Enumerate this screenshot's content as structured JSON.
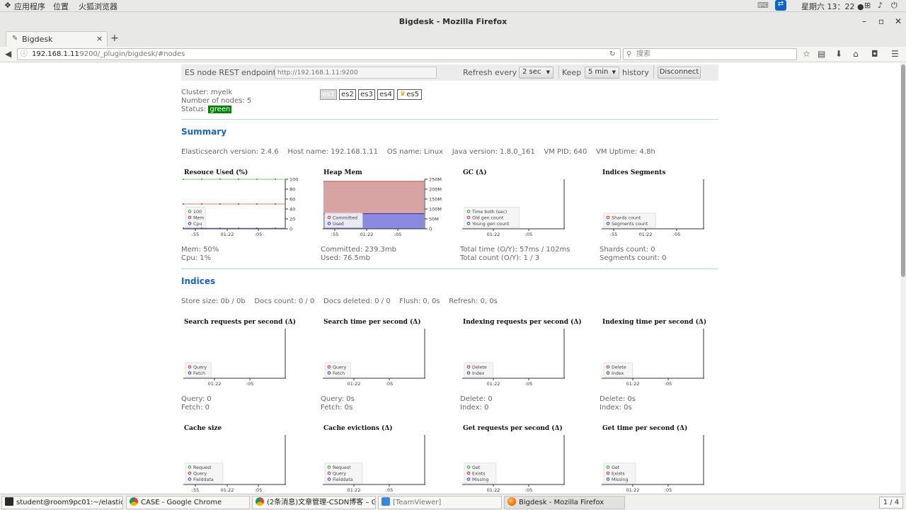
{
  "system_bar": {
    "apps": "应用程序",
    "places": "位置",
    "browser": "火狐浏览器",
    "clock": "星期六 13：22 ●"
  },
  "window": {
    "title": "Bigdesk - Mozilla Firefox"
  },
  "tab": {
    "label": "Bigdesk",
    "close": "×",
    "new_tab": "+"
  },
  "nav": {
    "url_host": "192.168.1.11",
    "url_rest": ":9200/_plugin/bigdesk/#nodes",
    "search_placeholder": "搜索"
  },
  "endpoint": {
    "label": "ES node REST endpoint",
    "placeholder": "http://192.168.1.11:9200",
    "refresh_label": "Refresh every",
    "refresh_value": "2 sec",
    "keep_label": "Keep",
    "keep_value": "5 min",
    "history_label": "history",
    "disconnect": "Disconnect"
  },
  "cluster": {
    "name_line": "Cluster: myelk",
    "nodes_line": "Number of nodes: 5",
    "status_label": "Status:",
    "status_value": "green",
    "status_color": "#008000",
    "nodes": [
      "es1",
      "es2",
      "es3",
      "es4",
      "es5"
    ],
    "selected": "es1"
  },
  "summary": {
    "heading": "Summary",
    "info": "Elasticsearch version: 2.4.6    Host name: 192.168.1.11    OS name: Linux    Java version: 1.8.0_161    VM PID: 640    VM Uptime: 4.8h"
  },
  "indices": {
    "heading": "Indices",
    "info": "Store size: 0b / 0b    Docs count: 0 / 0    Docs deleted: 0 / 0    Flush: 0, 0s    Refresh: 0, 0s"
  },
  "charts": [
    {
      "title": "Resouce Used (%)",
      "legend": [
        "100",
        "Mem",
        "Cpu"
      ],
      "colors": [
        "#2ca02c",
        "#d62728",
        "#1f3fbf"
      ],
      "yticks": [
        "100",
        "80",
        "60",
        "40",
        "20",
        "0"
      ],
      "xticks": [
        ":55",
        "01:22",
        ":05"
      ],
      "stats": [
        "Mem: 50%",
        "Cpu: 1%"
      ],
      "kind": "resource"
    },
    {
      "title": "Heap Mem",
      "legend": [
        "Committed",
        "Used"
      ],
      "colors": [
        "#d62728",
        "#1f3fbf"
      ],
      "yticks": [
        "250M",
        "200M",
        "150M",
        "100M",
        "50M",
        "0"
      ],
      "xticks": [
        ":55",
        "01:22",
        ":05"
      ],
      "stats": [
        "Committed: 239.3mb",
        "Used: 76.5mb"
      ],
      "kind": "heap"
    },
    {
      "title": "GC (Δ)",
      "legend": [
        "Time both (sec)",
        "Old gen count",
        "Young gen count"
      ],
      "colors": [
        "#2ca02c",
        "#d62728",
        "#1f3fbf"
      ],
      "yticks": [],
      "xticks": [
        "01:22",
        ":05"
      ],
      "stats": [
        "Total time (O/Y): 57ms / 102ms",
        "Total count (O/Y): 1 / 3"
      ],
      "kind": "empty"
    },
    {
      "title": "Indices Segments",
      "legend": [
        "Shards count",
        "Segments count"
      ],
      "colors": [
        "#d62728",
        "#1f3fbf"
      ],
      "yticks": [],
      "xticks": [
        ":55",
        "01:22",
        ":05"
      ],
      "stats": [
        "Shards count: 0",
        "Segments count: 0"
      ],
      "kind": "empty"
    },
    {
      "title": "Search requests per second (Δ)",
      "legend": [
        "Query",
        "Fetch"
      ],
      "colors": [
        "#d62728",
        "#1f3fbf"
      ],
      "yticks": [],
      "xticks": [
        "01:22",
        ":05"
      ],
      "stats": [
        "Query: 0",
        "Fetch: 0"
      ],
      "kind": "empty"
    },
    {
      "title": "Search time per second (Δ)",
      "legend": [
        "Query",
        "Fetch"
      ],
      "colors": [
        "#d62728",
        "#1f3fbf"
      ],
      "yticks": [],
      "xticks": [
        "01:22",
        ":05"
      ],
      "stats": [
        "Query: 0s",
        "Fetch: 0s"
      ],
      "kind": "empty"
    },
    {
      "title": "Indexing requests per second (Δ)",
      "legend": [
        "Delete",
        "Index"
      ],
      "colors": [
        "#d62728",
        "#1f3fbf"
      ],
      "yticks": [],
      "xticks": [
        "01:22",
        ":05"
      ],
      "stats": [
        "Delete: 0",
        "Index: 0"
      ],
      "kind": "empty"
    },
    {
      "title": "Indexing time per second (Δ)",
      "legend": [
        "Delete",
        "Index"
      ],
      "colors": [
        "#d62728",
        "#1f3fbf"
      ],
      "yticks": [],
      "xticks": [
        "01:22",
        ":05"
      ],
      "stats": [
        "Delete: 0s",
        "Index: 0s"
      ],
      "kind": "empty"
    },
    {
      "title": "Cache size",
      "legend": [
        "Request",
        "Query",
        "Fielddata"
      ],
      "colors": [
        "#2ca02c",
        "#d62728",
        "#1f3fbf"
      ],
      "yticks": [],
      "xticks": [
        ":55",
        "01:22",
        ":05"
      ],
      "stats": [],
      "kind": "empty"
    },
    {
      "title": "Cache evictions (Δ)",
      "legend": [
        "Request",
        "Query",
        "Fielddata"
      ],
      "colors": [
        "#2ca02c",
        "#d62728",
        "#1f3fbf"
      ],
      "yticks": [],
      "xticks": [
        "01:22",
        ":05"
      ],
      "stats": [],
      "kind": "empty"
    },
    {
      "title": "Get requests per second (Δ)",
      "legend": [
        "Get",
        "Exists",
        "Missing"
      ],
      "colors": [
        "#2ca02c",
        "#d62728",
        "#1f3fbf"
      ],
      "yticks": [],
      "xticks": [
        "01:22",
        ":05"
      ],
      "stats": [],
      "kind": "empty"
    },
    {
      "title": "Get time per second (Δ)",
      "legend": [
        "Get",
        "Exists",
        "Missing"
      ],
      "colors": [
        "#2ca02c",
        "#d62728",
        "#1f3fbf"
      ],
      "yticks": [],
      "xticks": [
        "01:22",
        ":05"
      ],
      "stats": [],
      "kind": "empty"
    }
  ],
  "chart_data": [
    {
      "type": "line",
      "title": "Resouce Used (%)",
      "ylim": [
        0,
        100
      ],
      "series": [
        {
          "name": "100",
          "values": [
            100,
            100,
            100,
            100,
            100,
            100,
            100,
            100,
            100,
            100,
            100,
            100
          ]
        },
        {
          "name": "Mem",
          "values": [
            50,
            50,
            50,
            50,
            50,
            50,
            50,
            50,
            50,
            50,
            50,
            50
          ]
        },
        {
          "name": "Cpu",
          "values": [
            1,
            1,
            1,
            1,
            1,
            1,
            1,
            1,
            1,
            1,
            1,
            1
          ]
        }
      ]
    },
    {
      "type": "area",
      "title": "Heap Mem",
      "ylim": [
        0,
        250
      ],
      "series": [
        {
          "name": "Committed",
          "values": [
            239.3,
            239.3,
            239.3,
            239.3,
            239.3,
            239.3,
            239.3,
            239.3,
            239.3,
            239.3,
            239.3,
            239.3
          ]
        },
        {
          "name": "Used",
          "values": [
            76.5,
            76.5,
            76.5,
            76.5,
            76.5,
            76.5,
            76.5,
            76.5,
            76.5,
            76.5,
            76.5,
            76.5
          ]
        }
      ]
    }
  ],
  "taskbar": {
    "items": [
      "student@room9pc01:~/elasticsearc···",
      "CASE - Google Chrome",
      "(2条消息)文章管理-CSDN博客 – G···",
      "[TeamViewer]",
      "Bigdesk - Mozilla Firefox"
    ],
    "active": 4,
    "workspace": "1 / 4"
  }
}
